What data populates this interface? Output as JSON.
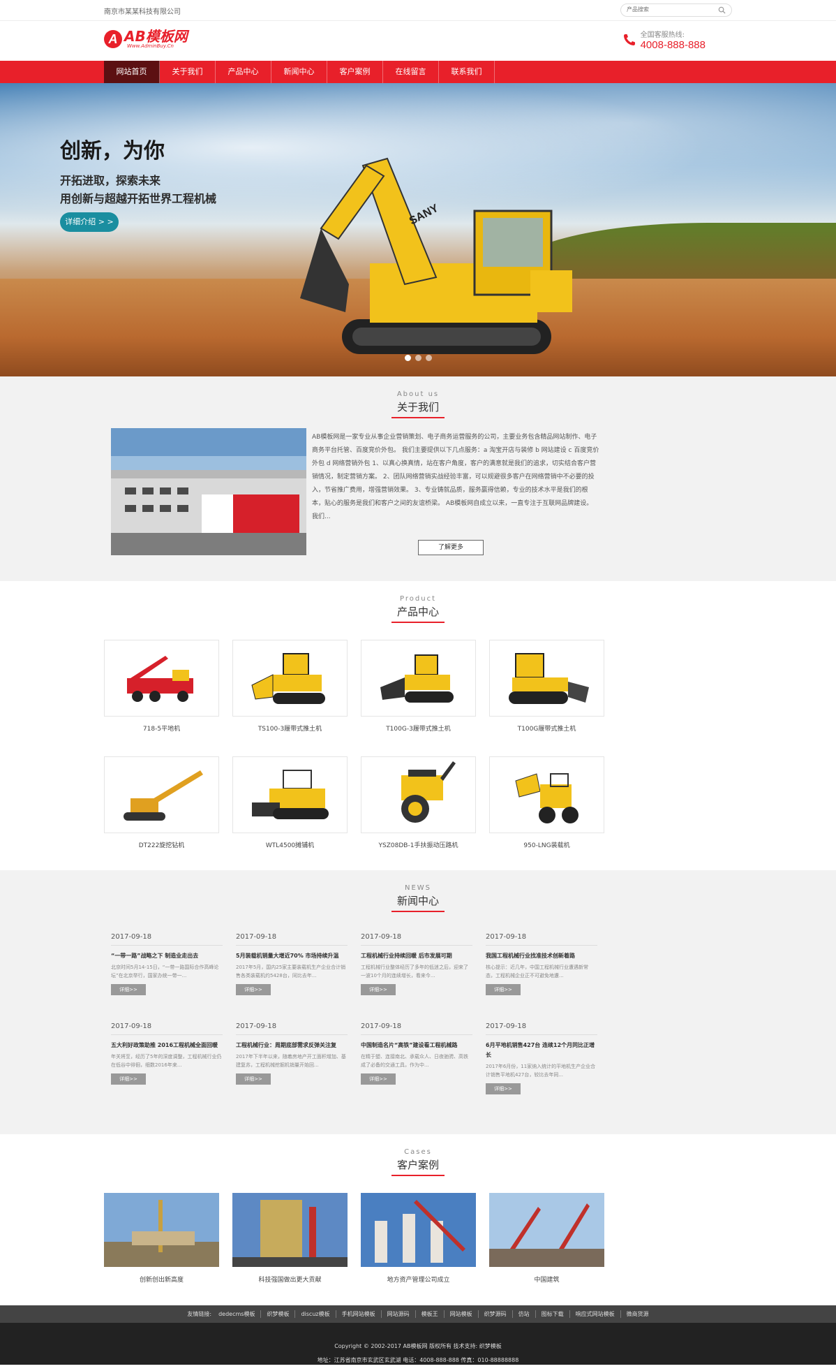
{
  "topbar": {
    "company": "南京市某某科技有限公司",
    "search_placeholder": "产品搜索"
  },
  "header": {
    "logo_main": "AB模板网",
    "logo_sub": "Www.AdminBuy.Cn",
    "hotline_label": "全国客服热线:",
    "hotline_number": "4008-888-888"
  },
  "nav": {
    "items": [
      {
        "label": "网站首页"
      },
      {
        "label": "关于我们"
      },
      {
        "label": "产品中心"
      },
      {
        "label": "新闻中心"
      },
      {
        "label": "客户案例"
      },
      {
        "label": "在线留言"
      },
      {
        "label": "联系我们"
      }
    ]
  },
  "banner": {
    "title": "创新，为你",
    "line1": "开拓进取，探索未来",
    "line2": "用创新与超越开拓世界工程机械",
    "button": "详细介绍 > >",
    "brand": "SANY"
  },
  "about": {
    "en": "About us",
    "cn": "关于我们",
    "text": "AB模板网是一家专业从事企业营销策划、电子商务运营服务的公司，主要业务包含精品网站制作、电子商务平台托管、百度竞价外包。 我们主要提供以下几点服务：a 淘宝开店与装修 b 网站建设 c 百度竞价外包 d 网络营销外包 1、以真心换真情，站在客户角度，客户的满意就是我们的追求，切实结合客户营销情况，制定营销方案。 2、团队网络营销实战经验丰富，可以规避很多客户在网络营销中不必要的投入，节省推广费用，增强营销效果。 3、专业铸就品质，服务赢得信赖，专业的技术水平是我们的根本，贴心的服务是我们和客户之间的友谊桥梁。 AB模板网自成立以来，一直专注于互联网品牌建设。 我们...",
    "more": "了解更多"
  },
  "products": {
    "en": "Product",
    "cn": "产品中心",
    "items": [
      {
        "name": "718-5平地机"
      },
      {
        "name": "TS100-3履带式推土机"
      },
      {
        "name": "T100G-3履带式推土机"
      },
      {
        "name": "T100G履带式推土机"
      },
      {
        "name": "DT222旋挖钻机"
      },
      {
        "name": "WTL4500摊铺机"
      },
      {
        "name": "YSZ08DB-1手扶振动压路机"
      },
      {
        "name": "950-LNG装载机"
      }
    ]
  },
  "news": {
    "en": "NEWS",
    "cn": "新闻中心",
    "btn": "详细>>",
    "items": [
      {
        "date": "2017-09-18",
        "title": "“一带一路”战略之下 制造业走出去",
        "summary": "北京时间5月14-15日，“一带一路国际合作高峰论坛”在北京举行，国家办统一带一..."
      },
      {
        "date": "2017-09-18",
        "title": "5月装载机销量大增近70% 市场持续升温",
        "summary": "2017年5月，国内25家主要装载机生产企业合计销售各类装载机约5428台，同比去年..."
      },
      {
        "date": "2017-09-18",
        "title": "工程机械行业持续回暖 后市发展可期",
        "summary": "工程机械行业整体经历了多年的低迷之后，迎来了一波10个月的连续增长，看来今..."
      },
      {
        "date": "2017-09-18",
        "title": "我国工程机械行业找准技术创新着路",
        "summary": "核心提示：近几年，中国工程机械行业遭遇新常态，工程机械企业正不可避免地遭..."
      },
      {
        "date": "2017-09-18",
        "title": "五大利好政策助推 2016工程机械全面回暖",
        "summary": "年关将至，经历了5年的深度调整，工程机械行业仍在低谷中徘徊，细数2016年来..."
      },
      {
        "date": "2017-09-18",
        "title": "工程机械行业：周期底部需求反弹关注复",
        "summary": "2017年下半年以来，随着房地产开工面积增加、基建复苏，工程机械挖掘机销量开始回..."
      },
      {
        "date": "2017-09-18",
        "title": "中国制造名片“高铁”建设看工程机械路",
        "summary": "在精于塑、连接南北、承载众人、日夜驰骋、高铁成了必备的交通工具，作为中..."
      },
      {
        "date": "2017-09-18",
        "title": "6月平地机销售427台 连续12个月同比正增长",
        "summary": "2017年6月份，11家纳入统计的平地机生产企业合计销售平地机427台，较比去年同..."
      }
    ]
  },
  "cases": {
    "en": "Cases",
    "cn": "客户案例",
    "items": [
      {
        "name": "创新创出新高度"
      },
      {
        "name": "科技强国做出更大贡献"
      },
      {
        "name": "地方资产管理公司成立"
      },
      {
        "name": "中国建筑"
      }
    ]
  },
  "footer": {
    "links_label": "友情链接:",
    "links": [
      "dedecms模板",
      "织梦模板",
      "discuz模板",
      "手机网站模板",
      "网站源码",
      "模板王",
      "网站模板",
      "织梦源码",
      "仿站",
      "图标下载",
      "响应式网站模板",
      "微商货源"
    ],
    "copyright": "Copyright © 2002-2017 AB模板网 版权所有 技术支持: 织梦模板",
    "address": "地址：江苏省南京市玄武区玄武湖 电话：4008-888-888 传真：010-88888888"
  },
  "colors": {
    "brand_red": "#e8202a",
    "nav_active": "#5c1012",
    "banner_btn": "#1a8ea0"
  }
}
